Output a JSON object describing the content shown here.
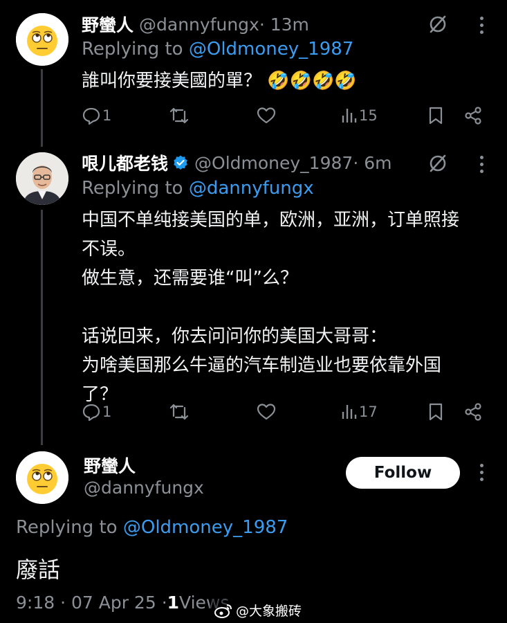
{
  "tweets": [
    {
      "name": "野蠻人",
      "handle": "@dannyfungx",
      "time": " · 13m",
      "replying_label": "Replying to ",
      "replying_to": "@Oldmoney_1987",
      "text": "誰叫你要接美國的單？ 🤣🤣🤣🤣",
      "stats": {
        "replies": "1",
        "views": "15"
      }
    },
    {
      "name": "哏儿都老钱",
      "verified": true,
      "handle": "@Oldmoney_1987",
      "time": " · 6m",
      "replying_label": "Replying to ",
      "replying_to": "@dannyfungx",
      "text": "中国不单纯接美国的单，欧洲，亚洲，订单照接\n不误。\n做生意，还需要谁“叫”么？\n\n话说回来，你去问问你的美国大哥哥：\n为啥美国那么牛逼的汽车制造业也要依靠外国\n了？",
      "stats": {
        "replies": "1",
        "views": "17"
      }
    }
  ],
  "main_tweet": {
    "name": "野蠻人",
    "handle": "@dannyfungx",
    "follow_label": "Follow",
    "replying_label": "Replying to ",
    "replying_to": "@Oldmoney_1987",
    "text": "廢話",
    "meta_time": "9:18 · 07 Apr 25 · ",
    "meta_views_count": "1",
    "meta_views_label": " Views"
  },
  "watermark": "@大象搬砖",
  "colors": {
    "background": "#000000",
    "link": "#3b9cf0",
    "muted": "#8b9096",
    "verified": "#1d9bf0"
  },
  "icons": [
    "reply-icon",
    "retweet-icon",
    "like-icon",
    "views-icon",
    "bookmark-icon",
    "share-icon",
    "grok-icon",
    "more-icon",
    "verified-badge-icon",
    "weibo-logo-icon"
  ]
}
